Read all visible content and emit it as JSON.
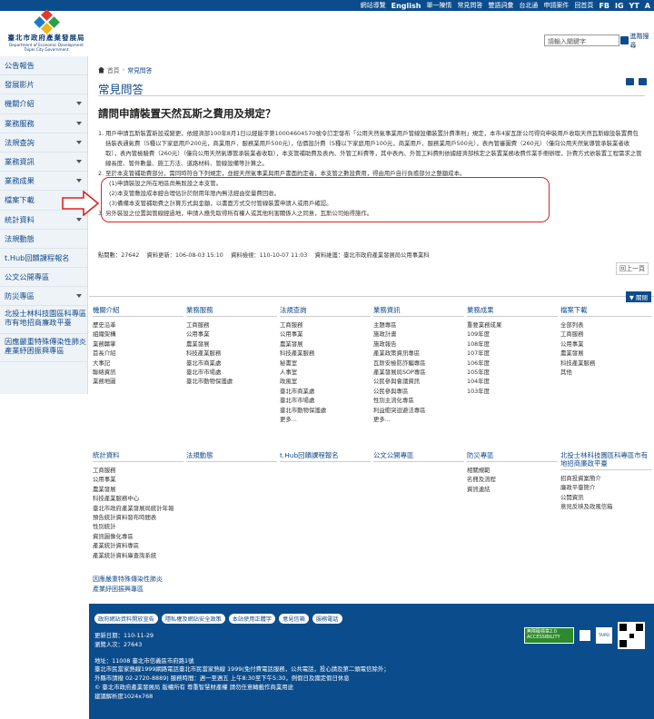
{
  "header": {
    "logo_cn": "臺北市政府產業發展局",
    "logo_en1": "Department of Economic Development",
    "logo_en2": "Taipei City Government",
    "top_links": [
      "網站導覽",
      "English",
      "單一陳情",
      "常見問答",
      "雙語詞彙",
      "台北通",
      "申請案件",
      "回首頁",
      "FB",
      "IG",
      "YT",
      "A"
    ],
    "search_placeholder": "請輸入關鍵字",
    "search_button": "進階搜尋"
  },
  "sidebar": {
    "items": [
      {
        "label": "公告報告",
        "caret": false
      },
      {
        "label": "發展影片",
        "caret": false
      },
      {
        "label": "機關介紹",
        "caret": true
      },
      {
        "label": "業務服務",
        "caret": true
      },
      {
        "label": "法規查詢",
        "caret": true
      },
      {
        "label": "業務資訊",
        "caret": true
      },
      {
        "label": "業務成果",
        "caret": true
      },
      {
        "label": "檔案下載",
        "caret": true
      },
      {
        "label": "統計資料",
        "caret": true
      },
      {
        "label": "法規動態",
        "caret": false
      },
      {
        "label": "t.Hub回饋課程報名",
        "caret": false
      },
      {
        "label": "公文公開專區",
        "caret": false
      },
      {
        "label": "防災專區",
        "caret": true
      },
      {
        "label": "北投士林科技園區科專區市有地招商廉政平臺",
        "caret": false
      },
      {
        "label": "因應嚴重特殊傳染性肺炎產業紓困振興專區",
        "caret": false
      }
    ]
  },
  "breadcrumb": {
    "home": "首頁",
    "sep": "›",
    "current": "常見問答"
  },
  "page_title": "常見問答",
  "question": "請問申請裝置天然瓦斯之費用及規定？",
  "answer": {
    "p1": "1. 用戶申請瓦斯裝置新設或變更，依經濟部100年8月1日以經能字第10004604570號令訂定發布「公用天然氣事業用戶管線設備裝置計費準則」規定，本市4家瓦斯公司得向申裝用戶收取天然瓦斯線設裝置費包括裝表通氣費（5種以下家庭用戶200元，商業用戶、服務業用戶500元），估價設計費（5種以下家庭用戶100元，商業用戶、服務業用戶500元），表內管審圖費（260元）（僅向公用天然氣導管承裝業者收取），表內管檢驗費（260元）（僅向公用天然氣導管承裝業者收取），本支管補助費及表內、外管工料費等，其中表內、外管工料費則依據經濟部核定之裝置業務收費作業手冊辦理，計費方式依裝置工程需求之管線長度、管件數量、施工方法、道路材料、管線設備等計算之。",
    "p2": "2. 至於本支管補助費部分，需同時符合下列規定，並經天然氣事業與用戶書面約定者，本支管之數設費用，得由用戶自行負擔部分之整額成本。",
    "p2a": "(1)申請裝設之所在地區尚無既設之本支管。",
    "p2b": "(2)本支管敷設成本經合理估計於耐用年限內無法經由從量費回收。",
    "p2c": "(3)備備本支管補助費之計算方式與金額，以書面方式交付管線裝置申請人或用戶確認。",
    "p3": "3. 另外裝設之位置與管線經過地，申請人應先取得所有權人或其他利害關係人之同意，瓦斯公司始得施作。"
  },
  "meta": {
    "clicks": "點閱數：27642",
    "updated": "資料更新：106-08-03 15:10",
    "checked": "資料檢視：110-10-07 11:03",
    "maintainer": "資料維護：臺北市政府產業發展局公用事業科"
  },
  "back_label": "回上一頁",
  "close_label": "▼ 關閉",
  "sitemap": {
    "columns": [
      {
        "title": "機關介紹",
        "items": [
          "歷史沿革",
          "組織架構",
          "業務職掌",
          "首長介紹",
          "大事記",
          "聯絡資訊",
          "業務地圖"
        ]
      },
      {
        "title": "業務服務",
        "items": [
          "工商服務",
          "公用事業",
          "農業發展",
          "科技產業服務",
          "臺北市商業處",
          "臺北市市場處",
          "臺北市動物保護處"
        ]
      },
      {
        "title": "法規查詢",
        "items": [
          "工商服務",
          "公用事業",
          "農業發展",
          "科技產業服務",
          "秘書室",
          "人事室",
          "政風室",
          "臺北市商業處",
          "臺北市市場處",
          "臺北市動物保護處",
          "更多..."
        ]
      },
      {
        "title": "業務資訊",
        "items": [
          "主題專區",
          "施政計畫",
          "施政報告",
          "產業政策資訊專區",
          "瓦斯安檢防詐騙專區",
          "產業發展局SOP專區",
          "公民參與會議資訊",
          "公民參與專區",
          "性別主流化專區",
          "利益衝突迴避法專區",
          "更多..."
        ]
      },
      {
        "title": "業務成果",
        "items": [
          "重要業務成果",
          "109年度",
          "108年度",
          "107年度",
          "106年度",
          "105年度",
          "104年度",
          "103年度"
        ]
      },
      {
        "title": "檔案下載",
        "items": [
          "全部列表",
          "工商服務",
          "公用事業",
          "農業發展",
          "科技產業服務",
          "其他"
        ]
      },
      {
        "title": "統計資料",
        "items": [
          "工商服務",
          "公用事業",
          "農業發展",
          "科技產業服務中心",
          "臺北市政府產業發展局統計年報",
          "預告統計資料發布時間表",
          "性別統計",
          "資訊圖像化專區",
          "產業統計資料專區",
          "產業統計資料庫查詢系統"
        ]
      },
      {
        "title": "法規動態",
        "items": []
      },
      {
        "title": "t.Hub回饋課程報名",
        "items": []
      },
      {
        "title": "公文公開專區",
        "items": []
      },
      {
        "title": "防災專區",
        "items": [
          "相關規範",
          "名冊及流程",
          "資訊連結"
        ]
      },
      {
        "title": "北投士林科技園區科專區市有地招商廉政平臺",
        "items": [
          "招商投資案簡介",
          "廉政平臺簡介",
          "公開資訊",
          "意見反映及政風信箱"
        ]
      }
    ],
    "extra_line1": "因應嚴重特殊傳染性肺炎",
    "extra_line2": "產業紓困振興專區"
  },
  "footer": {
    "buttons": [
      "政府網站資料開放宣告",
      "隱私權及網站安全政策",
      "本站使用正體字",
      "意見信箱",
      "服務電話"
    ],
    "lines": [
      "更新日期：110-11-29",
      "瀏覽人次：27643",
      "",
      "地址：11008 臺北市信義區市府路1號",
      "臺北市民當家熱線1999網路電話臺北市民當家熱線 1999(免付費電話服務，公共電話，投心請及第二頭電信除外；",
      "外縣市請撥 02-2720-8889) 服務時間：週一至週五 上午8:30至下午5:30，例假日及國定假日休息",
      "© 臺北市政府產業發展局 版權所有 尊重智慧財產權 請勿任意轉載作商業用途",
      "建議解析度1024x768"
    ],
    "acc_text": "無障礙標章2.0 ACCESSIBILITY",
    "badge_text": "TAIPEI"
  }
}
